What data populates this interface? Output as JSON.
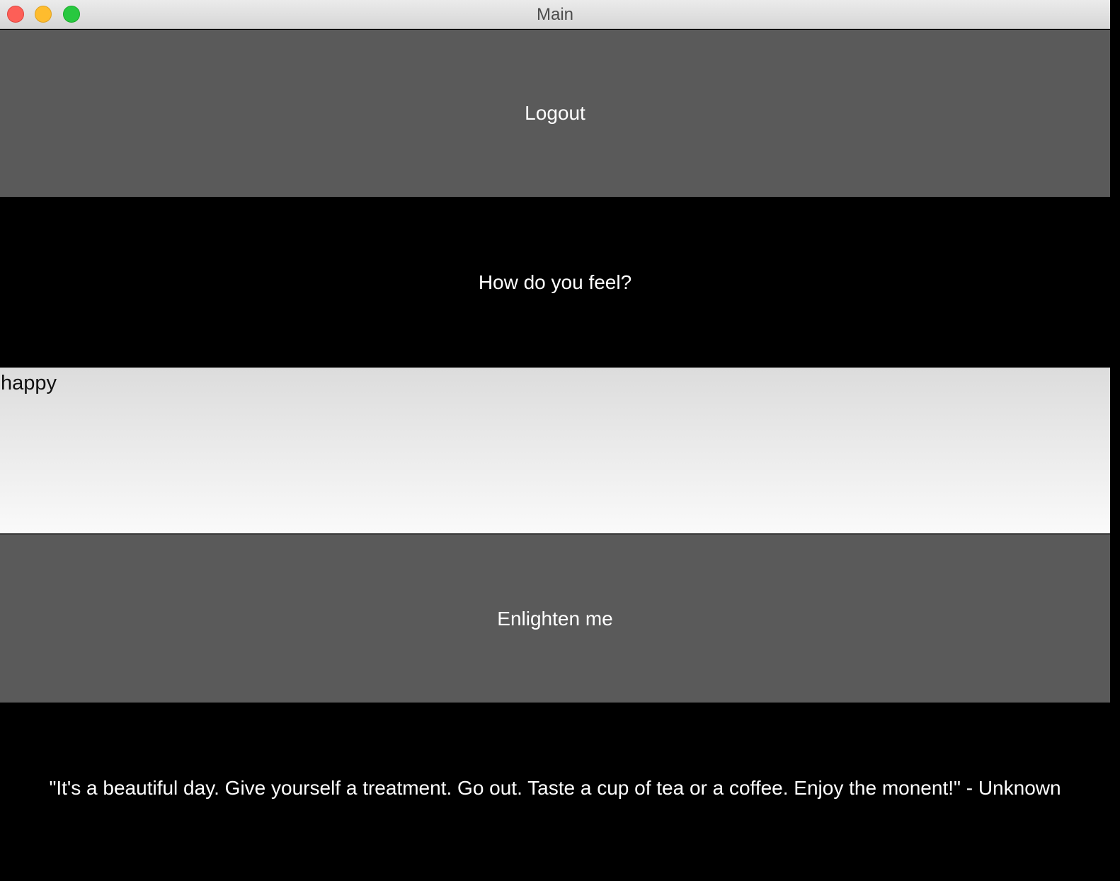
{
  "window": {
    "title": "Main"
  },
  "controls": {
    "logout_label": "Logout",
    "prompt_label": "How do you feel?",
    "mood_value": "happy",
    "enlighten_label": "Enlighten me"
  },
  "quote": {
    "text": "\"It's a beautiful day. Give yourself a treatment. Go out. Taste a cup of tea or a coffee. Enjoy the monent!\" - Unknown"
  },
  "colors": {
    "button_bg": "#5a5a5a",
    "dark_bg": "#000000",
    "text_light": "#ffffff",
    "close": "#fd5f57",
    "minimize": "#febc2e",
    "zoom": "#28c840"
  }
}
